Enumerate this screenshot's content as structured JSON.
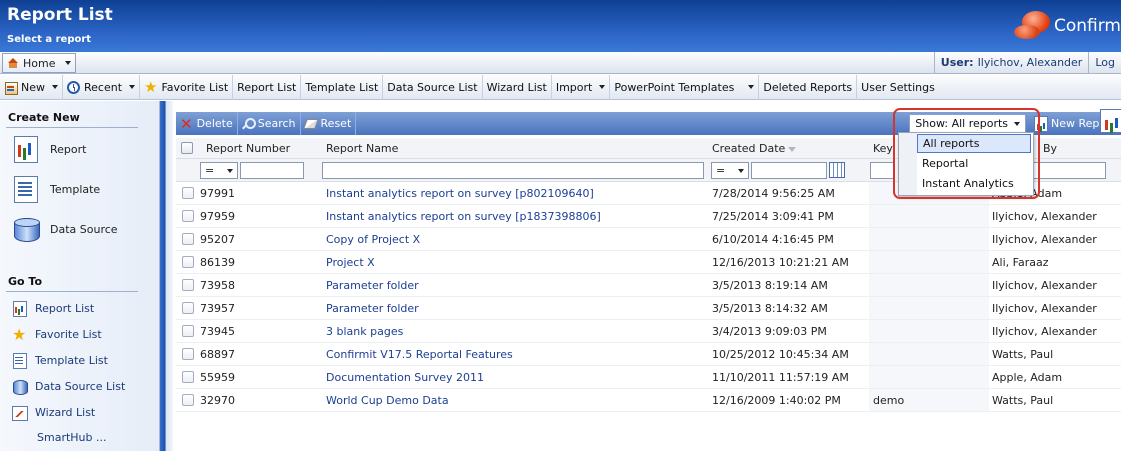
{
  "header": {
    "title": "Report List",
    "subtitle": "Select a report",
    "brand": "Confirm"
  },
  "homebar": {
    "home_tab": "Home",
    "user_label": "User:",
    "user_name": "Ilyichov, Alexander",
    "logout": "Log"
  },
  "menu": {
    "items": [
      {
        "label": "New"
      },
      {
        "label": "Recent"
      },
      {
        "label": "Favorite List"
      },
      {
        "label": "Report List"
      },
      {
        "label": "Template List"
      },
      {
        "label": "Data Source List"
      },
      {
        "label": "Wizard List"
      },
      {
        "label": "Import"
      },
      {
        "label": "PowerPoint Templates"
      },
      {
        "label": "Deleted Reports"
      },
      {
        "label": "User Settings"
      }
    ]
  },
  "sidebar": {
    "create_new_title": "Create New",
    "create_items": [
      {
        "label": "Report",
        "icon": "report-icon"
      },
      {
        "label": "Template",
        "icon": "template-icon"
      },
      {
        "label": "Data Source",
        "icon": "data-source-icon"
      }
    ],
    "goto_title": "Go To",
    "goto_items": [
      {
        "label": "Report List",
        "icon": "report-list-icon"
      },
      {
        "label": "Favorite List",
        "icon": "star-icon"
      },
      {
        "label": "Template List",
        "icon": "template-list-icon"
      },
      {
        "label": "Data Source List",
        "icon": "data-source-list-icon"
      },
      {
        "label": "Wizard List",
        "icon": "wizard-list-icon"
      },
      {
        "label": "SmartHub ..."
      }
    ]
  },
  "toolbar": {
    "delete": "Delete",
    "search": "Search",
    "reset": "Reset",
    "show_value": "Show: All reports",
    "new_report": "New Report"
  },
  "table": {
    "columns": {
      "number": "Report Number",
      "name": "Report Name",
      "created": "Created Date",
      "keywords": "Key",
      "by": "By"
    },
    "filter_op": "=",
    "rows": [
      {
        "number": "97991",
        "name": "Instant analytics report on survey [p802109640]",
        "created": "7/28/2014 9:56:25 AM",
        "keywords": "",
        "by": "Apple, Adam"
      },
      {
        "number": "97959",
        "name": "Instant analytics report on survey [p1837398806]",
        "created": "7/25/2014 3:09:41 PM",
        "keywords": "",
        "by": "Ilyichov, Alexander"
      },
      {
        "number": "95207",
        "name": "Copy of Project X",
        "created": "6/10/2014 4:16:45 PM",
        "keywords": "",
        "by": "Ilyichov, Alexander"
      },
      {
        "number": "86139",
        "name": "Project X",
        "created": "12/16/2013 10:21:21 AM",
        "keywords": "",
        "by": "Ali, Faraaz"
      },
      {
        "number": "73958",
        "name": "Parameter folder",
        "created": "3/5/2013 8:19:14 AM",
        "keywords": "",
        "by": "Ilyichov, Alexander"
      },
      {
        "number": "73957",
        "name": "Parameter folder",
        "created": "3/5/2013 8:14:32 AM",
        "keywords": "",
        "by": "Ilyichov, Alexander"
      },
      {
        "number": "73945",
        "name": "3 blank pages",
        "created": "3/4/2013 9:09:03 PM",
        "keywords": "",
        "by": "Ilyichov, Alexander"
      },
      {
        "number": "68897",
        "name": "Confirmit V17.5 Reportal Features",
        "created": "10/25/2012 10:45:34 AM",
        "keywords": "",
        "by": "Watts, Paul"
      },
      {
        "number": "55959",
        "name": "Documentation Survey 2011",
        "created": "11/10/2011 11:57:19 AM",
        "keywords": "",
        "by": "Apple, Adam"
      },
      {
        "number": "32970",
        "name": "World Cup Demo Data",
        "created": "12/16/2009 1:40:02 PM",
        "keywords": "demo",
        "by": "Watts, Paul"
      }
    ]
  },
  "show_dropdown": {
    "options": [
      "All reports",
      "Reportal",
      "Instant Analytics"
    ],
    "selected": "All reports"
  },
  "colors": {
    "header_blue": "#2a63c4",
    "link_blue": "#1c3f94",
    "callout_red": "#d6342e"
  }
}
